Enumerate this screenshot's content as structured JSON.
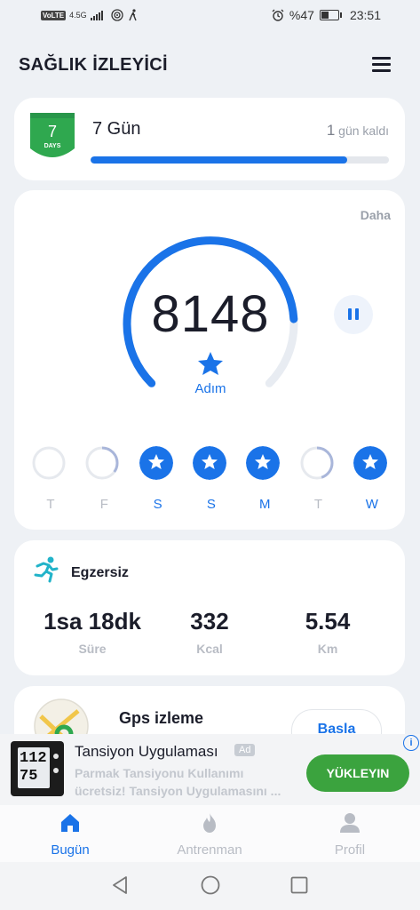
{
  "status_bar": {
    "volte": "VoLTE",
    "network": "4.5G",
    "battery_percent": "%47",
    "battery_level": 0.47,
    "time": "23:51",
    "icons": [
      "signal-icon",
      "wifi-icon",
      "walk-icon",
      "alarm-icon",
      "battery-icon"
    ]
  },
  "header": {
    "title": "SAĞLIK İZLEYİCİ",
    "menu_icon": "hamburger-menu-icon"
  },
  "streak": {
    "badge_number": "7",
    "badge_text": "DAYS",
    "title": "7 Gün",
    "remaining_count": "1",
    "remaining_text": " gün kaldı",
    "progress": 0.86
  },
  "steps": {
    "more_label": "Daha",
    "count": "8148",
    "unit_label": "Adım",
    "goal_progress": 0.82,
    "week": [
      {
        "label": "T",
        "state": "empty",
        "progress": 0
      },
      {
        "label": "F",
        "state": "partial",
        "progress": 0.35
      },
      {
        "label": "S",
        "state": "done",
        "progress": 1
      },
      {
        "label": "S",
        "state": "done",
        "progress": 1
      },
      {
        "label": "M",
        "state": "done",
        "progress": 1
      },
      {
        "label": "T",
        "state": "partial",
        "progress": 0.45
      },
      {
        "label": "W",
        "state": "done",
        "progress": 1
      }
    ]
  },
  "exercise": {
    "title": "Egzersiz",
    "icon": "running-icon",
    "stats": [
      {
        "value": "1sa 18dk",
        "label": "Süre"
      },
      {
        "value": "332",
        "label": "Kcal"
      },
      {
        "value": "5.54",
        "label": "Km"
      }
    ]
  },
  "gps": {
    "title": "Gps izleme",
    "button": "Basla"
  },
  "ad": {
    "title": "Tansiyon Uygulaması",
    "tag": "Ad",
    "description": "Parmak Tansiyonu Kullanımı ücretsiz! Tansiyon Uygulamasını ...",
    "button": "YÜKLEYIN",
    "info": "i",
    "monitor_top": "112",
    "monitor_bottom": "75"
  },
  "bottom_nav": [
    {
      "label": "Bugün",
      "icon": "home-icon",
      "active": true
    },
    {
      "label": "Antrenman",
      "icon": "flame-icon",
      "active": false
    },
    {
      "label": "Profil",
      "icon": "profile-icon",
      "active": false
    }
  ],
  "colors": {
    "accent": "#1a73e8",
    "background": "#eef1f5",
    "badge_green": "#2fa84f",
    "install_green": "#3ba33e",
    "muted": "#b8bcc4"
  }
}
